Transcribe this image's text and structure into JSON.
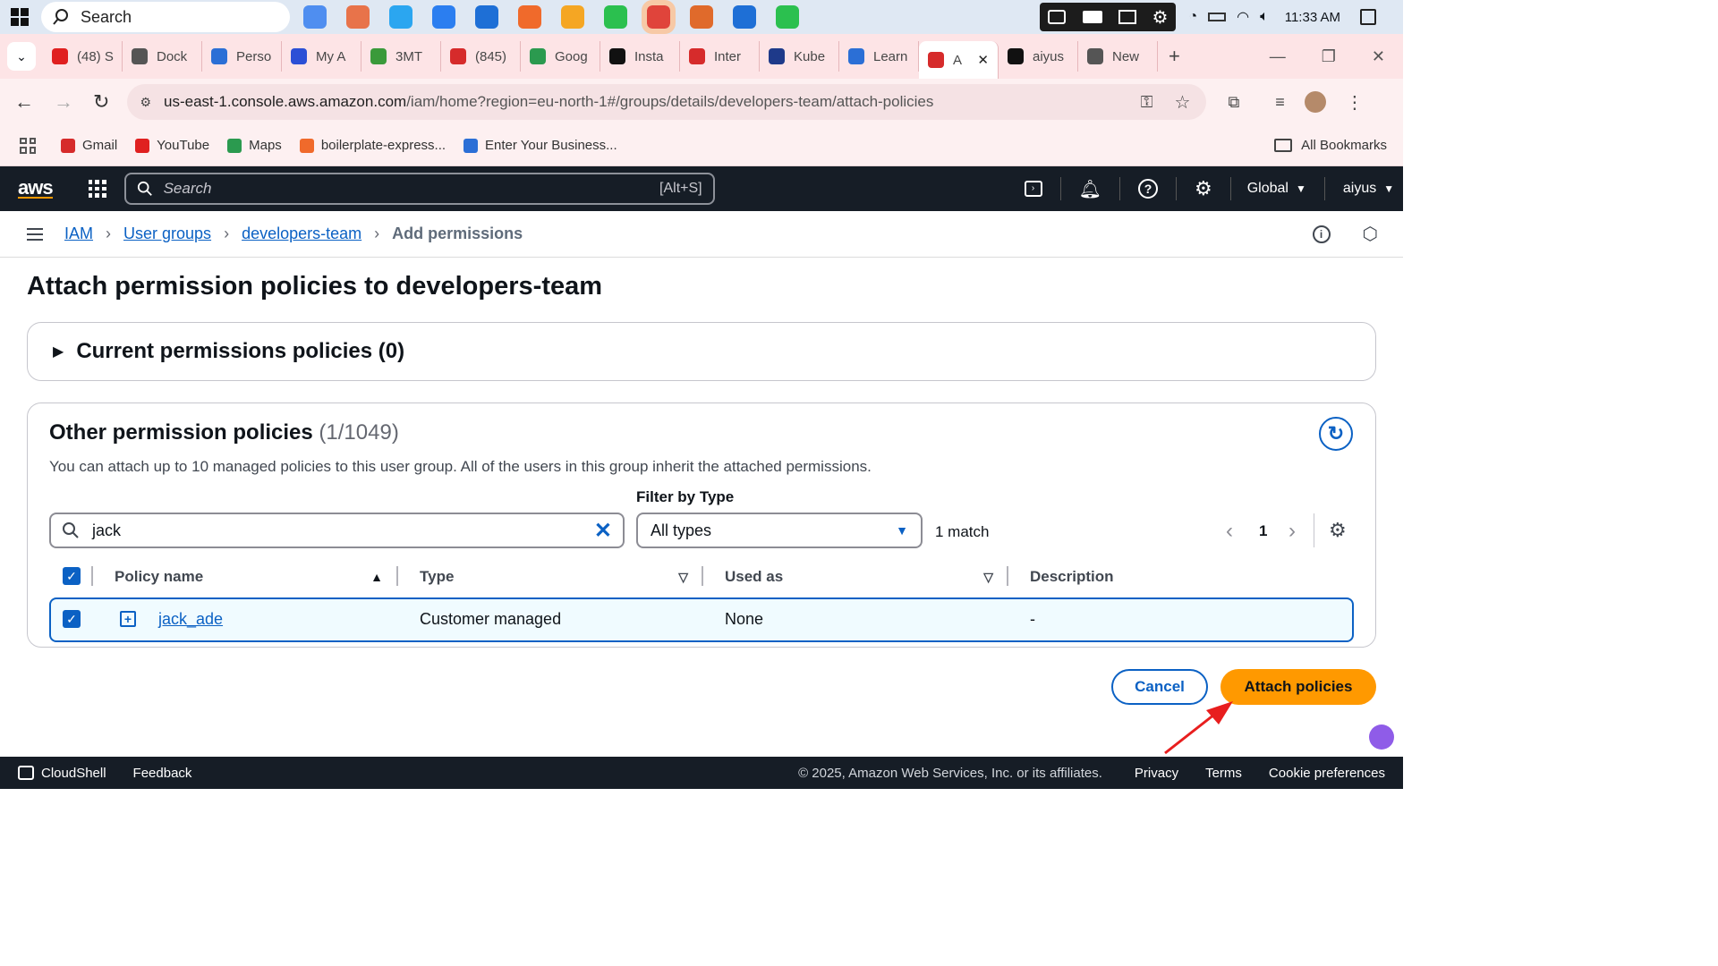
{
  "taskbar": {
    "search_placeholder": "Search",
    "time": "11:33 AM",
    "app_colors": [
      "#4f8ef0",
      "#e8734a",
      "#2ba6f0",
      "#2b7ef0",
      "#1e6fd6",
      "#f06a2b",
      "#f5a623",
      "#2bc04f",
      "#e0443b",
      "#e06a2b",
      "#1e6fd6",
      "#2bc04f"
    ]
  },
  "browser": {
    "tabs": [
      {
        "label": "(48) S",
        "color": "#e02020"
      },
      {
        "label": "Dock",
        "color": "#555555"
      },
      {
        "label": "Perso",
        "color": "#2b6fd6"
      },
      {
        "label": "My A",
        "color": "#2b4fd6"
      },
      {
        "label": "3MT",
        "color": "#3a9a3a"
      },
      {
        "label": "(845)",
        "color": "#d62b2b"
      },
      {
        "label": "Goog",
        "color": "#2b9a4f"
      },
      {
        "label": "Insta",
        "color": "#111111"
      },
      {
        "label": "Inter",
        "color": "#d62b2b"
      },
      {
        "label": "Kube",
        "color": "#1e3a8a"
      },
      {
        "label": "Learn",
        "color": "#2b6fd6"
      },
      {
        "label": "A",
        "color": "#d62b2b",
        "active": true
      },
      {
        "label": "aiyus",
        "color": "#111111"
      },
      {
        "label": "New",
        "color": "#555555"
      }
    ],
    "new_tab": "+",
    "url_host": "us-east-1.console.aws.amazon.com",
    "url_path": "/iam/home?region=eu-north-1#/groups/details/developers-team/attach-policies",
    "bookmarks": [
      {
        "label": "Gmail",
        "color": "#d62b2b"
      },
      {
        "label": "YouTube",
        "color": "#e02020"
      },
      {
        "label": "Maps",
        "color": "#2b9a4f"
      },
      {
        "label": "boilerplate-express...",
        "color": "#f06a2b"
      },
      {
        "label": "Enter Your Business...",
        "color": "#2b6fd6"
      }
    ],
    "all_bookmarks": "All Bookmarks"
  },
  "aws": {
    "logo": "aws",
    "search_placeholder": "Search",
    "search_shortcut": "[Alt+S]",
    "region": "Global",
    "account": "aiyus"
  },
  "breadcrumb": {
    "items": [
      "IAM",
      "User groups",
      "developers-team"
    ],
    "current": "Add permissions"
  },
  "page": {
    "title": "Attach permission policies to developers-team",
    "current_section": "Current permissions policies (0)",
    "other_title": "Other permission policies",
    "other_count": "(1/1049)",
    "description": "You can attach up to 10 managed policies to this user group. All of the users in this group inherit the attached permissions.",
    "filter_label": "Filter by Type",
    "search_value": "jack",
    "filter_value": "All types",
    "match_text": "1 match",
    "page_number": "1",
    "columns": [
      "Policy name",
      "Type",
      "Used as",
      "Description"
    ],
    "rows": [
      {
        "name": "jack_ade",
        "type": "Customer managed",
        "used_as": "None",
        "description": "-"
      }
    ],
    "cancel": "Cancel",
    "attach": "Attach policies"
  },
  "footer": {
    "cloudshell": "CloudShell",
    "feedback": "Feedback",
    "copyright": "© 2025, Amazon Web Services, Inc. or its affiliates.",
    "privacy": "Privacy",
    "terms": "Terms",
    "cookie": "Cookie preferences"
  }
}
